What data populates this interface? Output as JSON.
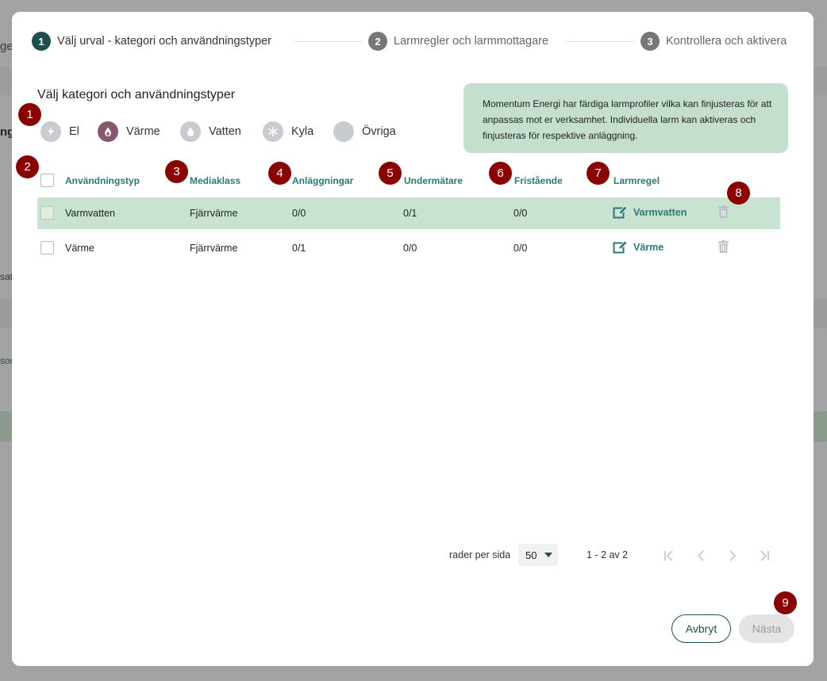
{
  "background": {
    "fragment_1": "ge",
    "fragment_2": "ng",
    "fragment_3": "sati",
    "fragment_4": "sor"
  },
  "stepper": {
    "steps": [
      {
        "num": "1",
        "label": "Välj urval - kategori och användningstyper",
        "state": "active"
      },
      {
        "num": "2",
        "label": "Larmregler och larmmottagare",
        "state": "inactive"
      },
      {
        "num": "3",
        "label": "Kontrollera och aktivera",
        "state": "inactive"
      }
    ]
  },
  "section_title": "Välj kategori och användningstyper",
  "info_text": "Momentum Energi har färdiga larmprofiler vilka kan finjusteras för att anpassas mot er verksamhet. Individuella larm kan aktiveras och finjusteras för respektive anläggning.",
  "categories": [
    {
      "label": "El",
      "icon": "lightning-icon",
      "selected": false
    },
    {
      "label": "Värme",
      "icon": "flame-drop-icon",
      "selected": true
    },
    {
      "label": "Vatten",
      "icon": "water-drop-icon",
      "selected": false
    },
    {
      "label": "Kyla",
      "icon": "snowflake-icon",
      "selected": false
    },
    {
      "label": "Övriga",
      "icon": "",
      "selected": false
    }
  ],
  "badges": [
    "1",
    "2",
    "3",
    "4",
    "5",
    "6",
    "7",
    "8",
    "9"
  ],
  "table": {
    "columns": [
      "Användningstyp",
      "Mediaklass",
      "Anläggningar",
      "Undermätare",
      "Fristående",
      "Larmregel"
    ],
    "rows": [
      {
        "type": "Varmvatten",
        "media": "Fjärrvärme",
        "facilities": "0/0",
        "submeters": "0/1",
        "standalone": "0/0",
        "rule": "Varmvatten",
        "highlight": true
      },
      {
        "type": "Värme",
        "media": "Fjärrvärme",
        "facilities": "0/1",
        "submeters": "0/0",
        "standalone": "0/0",
        "rule": "Värme",
        "highlight": false
      }
    ]
  },
  "pagination": {
    "rows_per_page_label": "rader per sida",
    "rows_per_page_value": "50",
    "range": "1 - 2 av 2"
  },
  "buttons": {
    "cancel": "Avbryt",
    "next": "Nästa"
  },
  "colors": {
    "accent": "#1e4f4f",
    "link": "#2b7a78",
    "highlight_row": "#c8e3cf",
    "badge": "#8b0000",
    "selected_category": "#86566f"
  }
}
